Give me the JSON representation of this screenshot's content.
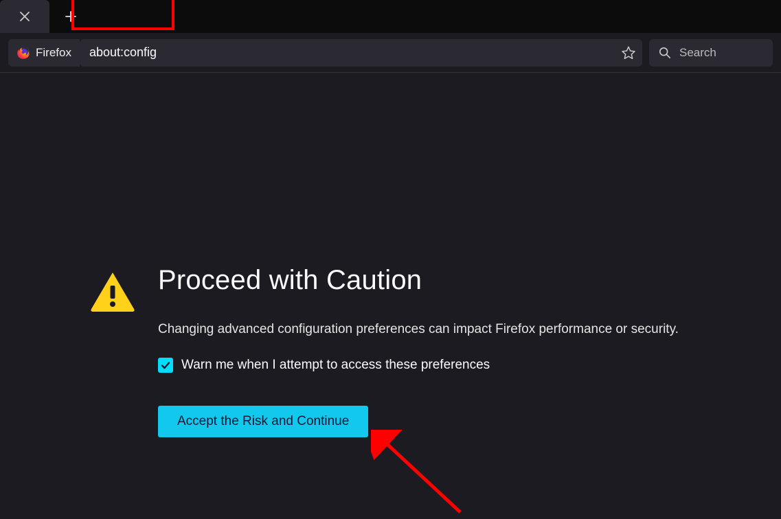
{
  "tabbar": {
    "close_label": "Close tab",
    "newtab_label": "New tab"
  },
  "toolbar": {
    "identity_label": "Firefox",
    "url_value": "about:config",
    "bookmark_label": "Bookmark this page",
    "search_placeholder": "Search"
  },
  "warning": {
    "title": "Proceed with Caution",
    "description": "Changing advanced configuration preferences can impact Firefox performance or security.",
    "checkbox_label": "Warn me when I attempt to access these preferences",
    "checkbox_checked": true,
    "accept_button": "Accept the Risk and Continue"
  },
  "icons": {
    "warning": "warning-triangle",
    "firefox": "firefox-logo",
    "star": "star-outline",
    "search": "magnifier",
    "close": "x",
    "plus": "plus",
    "check": "check"
  }
}
